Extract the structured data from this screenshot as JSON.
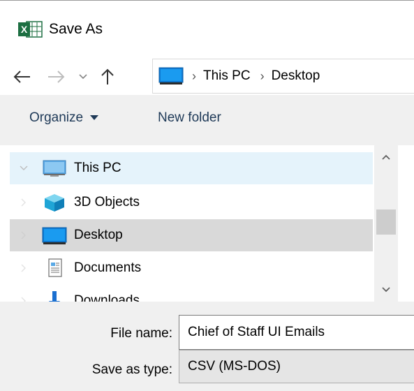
{
  "window": {
    "title": "Save As",
    "app_icon": "excel-icon"
  },
  "nav": {
    "back_icon": "back-arrow-icon",
    "forward_icon": "forward-arrow-icon",
    "recent_icon": "chevron-down-icon",
    "up_icon": "up-arrow-icon"
  },
  "address": {
    "segments": [
      "This PC",
      "Desktop"
    ]
  },
  "toolbar": {
    "organize_label": "Organize",
    "new_folder_label": "New folder"
  },
  "tree": {
    "items": [
      {
        "label": "This PC",
        "icon": "computer-icon",
        "state": "hover"
      },
      {
        "label": "3D Objects",
        "icon": "cube-icon",
        "state": "normal"
      },
      {
        "label": "Desktop",
        "icon": "desktop-icon",
        "state": "selected"
      },
      {
        "label": "Documents",
        "icon": "document-icon",
        "state": "normal"
      },
      {
        "label": "Downloads",
        "icon": "download-icon",
        "state": "normal"
      }
    ]
  },
  "form": {
    "file_name_label": "File name:",
    "file_name_value": "Chief of Staff UI Emails",
    "save_type_label": "Save as type:",
    "save_type_value": "CSV (MS-DOS)"
  },
  "colors": {
    "accent": "#0078d7",
    "toolbar_bg": "#f0f0f0",
    "hover_bg": "#e5f3fb",
    "selected_bg": "#d9d9d9",
    "excel_green": "#1d6f42"
  }
}
